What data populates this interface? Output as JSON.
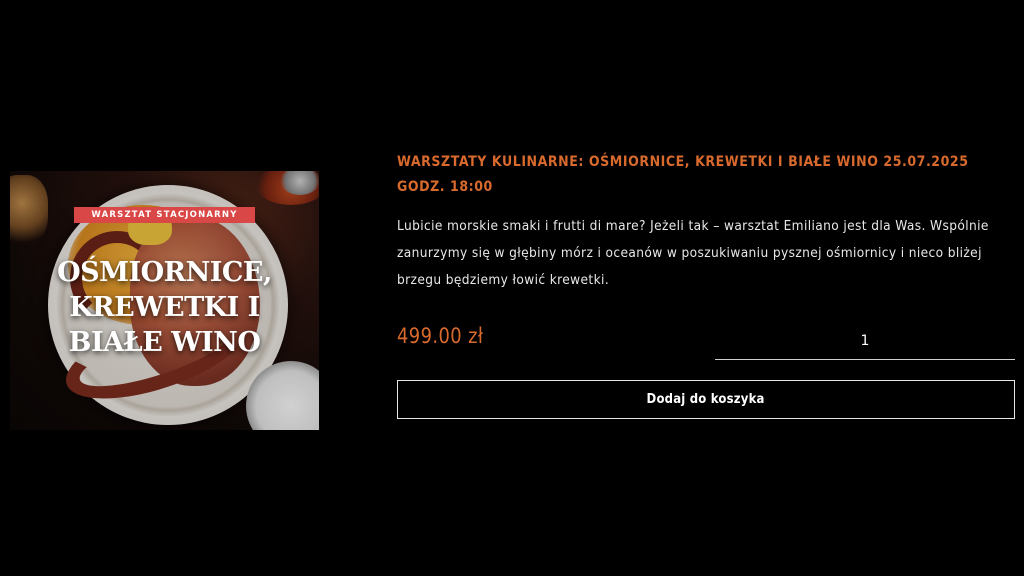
{
  "product": {
    "image": {
      "badge": "WARSZTAT STACJONARNY",
      "title_lines": [
        "OŚMIORNICE,",
        "KREWETKI I",
        "BIAŁE WINO"
      ]
    },
    "title": "WARSZTATY KULINARNE: OŚMIORNICE, KREWETKI I BIAŁE WINO 25.07.2025 GODZ. 18:00",
    "description": "Lubicie morskie smaki i frutti di mare? Jeżeli tak – warsztat Emiliano jest dla Was. Wspólnie zanurzymy się w głębiny mórz i oceanów w poszukiwaniu pysznej ośmiornicy i nieco bliżej brzegu będziemy łowić krewetki.",
    "price": "499.00 zł",
    "quantity": "1",
    "add_to_cart_label": "Dodaj do koszyka"
  },
  "colors": {
    "accent": "#d86a2e",
    "badge": "#d94746",
    "background": "#000000"
  }
}
